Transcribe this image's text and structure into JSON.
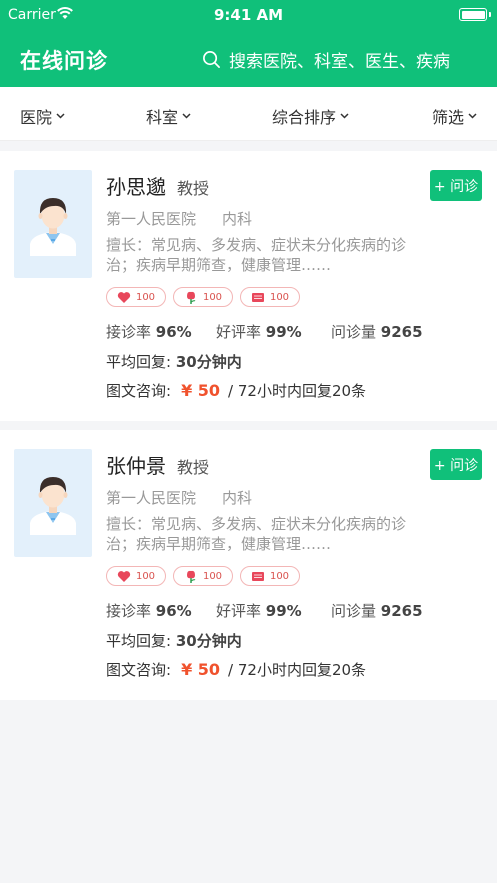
{
  "status_bar": {
    "carrier": "Carrier",
    "time": "9:41 AM"
  },
  "nav": {
    "title": "在线问诊",
    "search_placeholder": "搜索医院、科室、医生、疾病"
  },
  "filters": [
    "医院",
    "科室",
    "综合排序",
    "筛选"
  ],
  "doctors": [
    {
      "name": "孙思邈",
      "title": "教授",
      "ask_label": "+ 问诊",
      "hospital": "第一人民医院",
      "department": "内科",
      "skill": "擅长：常见病、多发病、症状未分化疾病的诊治；疾病早期筛查，健康管理……",
      "tags": [
        {
          "icon": "heart-icon",
          "count": "100"
        },
        {
          "icon": "flower-icon",
          "count": "100"
        },
        {
          "icon": "book-icon",
          "count": "100"
        }
      ],
      "accept_label": "接诊率",
      "accept_value": "96%",
      "praise_label": "好评率",
      "praise_value": "99%",
      "visits_label": "问诊量",
      "visits_value": "9265",
      "reply_label": "平均回复:",
      "reply_value": "30分钟内",
      "consult_label": "图文咨询:",
      "consult_price": "¥ 50",
      "consult_desc": "/ 72小时内回复20条"
    },
    {
      "name": "张仲景",
      "title": "教授",
      "ask_label": "+ 问诊",
      "hospital": "第一人民医院",
      "department": "内科",
      "skill": "擅长：常见病、多发病、症状未分化疾病的诊治；疾病早期筛查，健康管理……",
      "tags": [
        {
          "icon": "heart-icon",
          "count": "100"
        },
        {
          "icon": "flower-icon",
          "count": "100"
        },
        {
          "icon": "book-icon",
          "count": "100"
        }
      ],
      "accept_label": "接诊率",
      "accept_value": "96%",
      "praise_label": "好评率",
      "praise_value": "99%",
      "visits_label": "问诊量",
      "visits_value": "9265",
      "reply_label": "平均回复:",
      "reply_value": "30分钟内",
      "consult_label": "图文咨询:",
      "consult_price": "¥ 50",
      "consult_desc": "/ 72小时内回复20条"
    }
  ],
  "colors": {
    "primary": "#10c07a",
    "price": "#f0522d",
    "background": "#f4f5f7"
  }
}
